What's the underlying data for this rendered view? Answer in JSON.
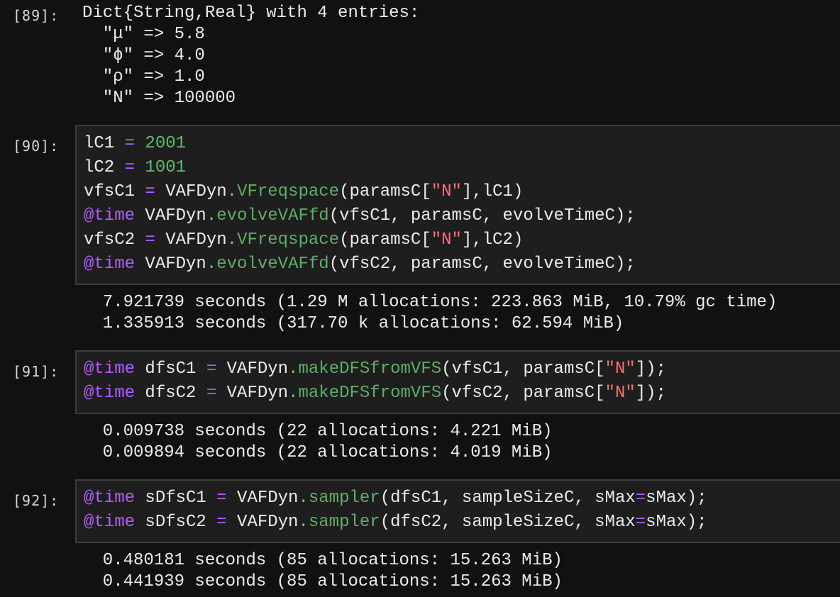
{
  "cells": [
    {
      "prompt": "[89]:",
      "output_lines": [
        "Dict{String,Real} with 4 entries:",
        "  \"μ\" => 5.8",
        "  \"ϕ\" => 4.0",
        "  \"ρ\" => 1.0",
        "  \"N\" => 100000"
      ]
    },
    {
      "prompt": "[90]:",
      "code_lines": [
        [
          [
            "plain",
            "lC1 "
          ],
          [
            "op",
            "="
          ],
          [
            "num",
            " 2001"
          ]
        ],
        [
          [
            "plain",
            "lC2 "
          ],
          [
            "op",
            "="
          ],
          [
            "num",
            " 1001"
          ]
        ],
        [
          [
            "plain",
            "vfsC1 "
          ],
          [
            "op",
            "="
          ],
          [
            "plain",
            " VAFDyn"
          ],
          [
            "dot",
            "."
          ],
          [
            "fn",
            "VFreqspace"
          ],
          [
            "plain",
            "(paramsC["
          ],
          [
            "str",
            "\"N\""
          ],
          [
            "plain",
            "],lC1)"
          ]
        ],
        [
          [
            "macro",
            "@time"
          ],
          [
            "plain",
            " VAFDyn"
          ],
          [
            "dot",
            "."
          ],
          [
            "fn",
            "evolveVAFfd"
          ],
          [
            "plain",
            "(vfsC1, paramsC, evolveTimeC);"
          ]
        ],
        [
          [
            "plain",
            "vfsC2 "
          ],
          [
            "op",
            "="
          ],
          [
            "plain",
            " VAFDyn"
          ],
          [
            "dot",
            "."
          ],
          [
            "fn",
            "VFreqspace"
          ],
          [
            "plain",
            "(paramsC["
          ],
          [
            "str",
            "\"N\""
          ],
          [
            "plain",
            "],lC2)"
          ]
        ],
        [
          [
            "macro",
            "@time"
          ],
          [
            "plain",
            " VAFDyn"
          ],
          [
            "dot",
            "."
          ],
          [
            "fn",
            "evolveVAFfd"
          ],
          [
            "plain",
            "(vfsC2, paramsC, evolveTimeC);"
          ]
        ]
      ],
      "output_lines": [
        "  7.921739 seconds (1.29 M allocations: 223.863 MiB, 10.79% gc time)",
        "  1.335913 seconds (317.70 k allocations: 62.594 MiB)"
      ]
    },
    {
      "prompt": "[91]:",
      "code_lines": [
        [
          [
            "macro",
            "@time"
          ],
          [
            "plain",
            " dfsC1 "
          ],
          [
            "op",
            "="
          ],
          [
            "plain",
            " VAFDyn"
          ],
          [
            "dot",
            "."
          ],
          [
            "fn",
            "makeDFSfromVFS"
          ],
          [
            "plain",
            "(vfsC1, paramsC["
          ],
          [
            "str",
            "\"N\""
          ],
          [
            "plain",
            "]);"
          ]
        ],
        [
          [
            "macro",
            "@time"
          ],
          [
            "plain",
            " dfsC2 "
          ],
          [
            "op",
            "="
          ],
          [
            "plain",
            " VAFDyn"
          ],
          [
            "dot",
            "."
          ],
          [
            "fn",
            "makeDFSfromVFS"
          ],
          [
            "plain",
            "(vfsC2, paramsC["
          ],
          [
            "str",
            "\"N\""
          ],
          [
            "plain",
            "]);"
          ]
        ]
      ],
      "output_lines": [
        "  0.009738 seconds (22 allocations: 4.221 MiB)",
        "  0.009894 seconds (22 allocations: 4.019 MiB)"
      ]
    },
    {
      "prompt": "[92]:",
      "code_lines": [
        [
          [
            "macro",
            "@time"
          ],
          [
            "plain",
            " sDfsC1 "
          ],
          [
            "op",
            "="
          ],
          [
            "plain",
            " VAFDyn"
          ],
          [
            "dot",
            "."
          ],
          [
            "fn",
            "sampler"
          ],
          [
            "plain",
            "(dfsC1, sampleSizeC, sMax"
          ],
          [
            "op",
            "="
          ],
          [
            "plain",
            "sMax);"
          ]
        ],
        [
          [
            "macro",
            "@time"
          ],
          [
            "plain",
            " sDfsC2 "
          ],
          [
            "op",
            "="
          ],
          [
            "plain",
            " VAFDyn"
          ],
          [
            "dot",
            "."
          ],
          [
            "fn",
            "sampler"
          ],
          [
            "plain",
            "(dfsC2, sampleSizeC, sMax"
          ],
          [
            "op",
            "="
          ],
          [
            "plain",
            "sMax);"
          ]
        ]
      ],
      "output_lines": [
        "  0.480181 seconds (85 allocations: 15.263 MiB)",
        "  0.441939 seconds (85 allocations: 15.263 MiB)"
      ]
    }
  ]
}
